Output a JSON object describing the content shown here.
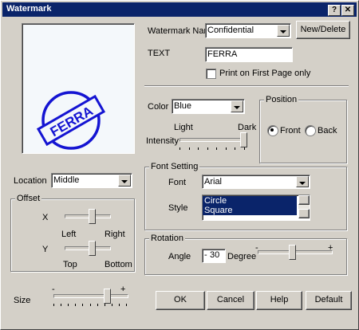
{
  "window": {
    "title": "Watermark",
    "help_glyph": "?",
    "close_glyph": "✕"
  },
  "preview": {
    "stamp_text": "FERRA",
    "stamp_color": "#1414d2"
  },
  "watermark_name": {
    "label": "Watermark Name",
    "value": "Confidential",
    "new_delete_label": "New/Delete"
  },
  "text_field": {
    "label": "TEXT",
    "value": "FERRA"
  },
  "first_page": {
    "label": "Print on First Page only",
    "checked": false
  },
  "color": {
    "label": "Color",
    "value": "Blue"
  },
  "intensity": {
    "label": "Intensity",
    "light_label": "Light",
    "dark_label": "Dark",
    "level": 1.0
  },
  "position": {
    "group_label": "Position",
    "front_label": "Front",
    "back_label": "Back",
    "selected": "Front"
  },
  "location": {
    "label": "Location",
    "value": "Middle"
  },
  "offset": {
    "group_label": "Offset",
    "x_label": "X",
    "left_label": "Left",
    "right_label": "Right",
    "x_level": 0.6,
    "y_label": "Y",
    "top_label": "Top",
    "bottom_label": "Bottom",
    "y_level": 0.6
  },
  "font_setting": {
    "group_label": "Font Setting",
    "font_label": "Font",
    "font_value": "Arial",
    "style_label": "Style",
    "style_options": [
      "Circle",
      "Square"
    ],
    "style_selected": [
      "Circle",
      "Square"
    ]
  },
  "rotation": {
    "group_label": "Rotation",
    "angle_label": "Angle",
    "sign": "-",
    "angle_value": "30",
    "degree_label": "Degree",
    "minus_mark": "-",
    "plus_mark": "+",
    "level": 0.45
  },
  "size": {
    "label": "Size",
    "minus_mark": "-",
    "plus_mark": "+",
    "level": 0.73
  },
  "buttons": {
    "ok": "OK",
    "cancel": "Cancel",
    "help": "Help",
    "default": "Default"
  }
}
